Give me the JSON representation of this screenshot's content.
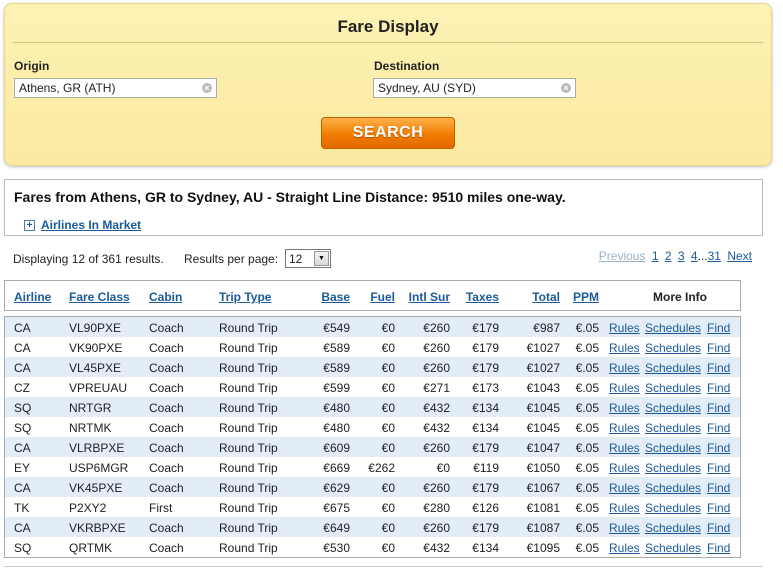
{
  "search": {
    "title": "Fare Display",
    "origin_label": "Origin",
    "origin_value": "Athens, GR (ATH)",
    "destination_label": "Destination",
    "destination_value": "Sydney, AU (SYD)",
    "clear_glyph": "×",
    "search_label": "SEARCH"
  },
  "info": {
    "title": "Fares from Athens, GR to Sydney, AU - Straight Line Distance: 9510 miles one-way.",
    "expand_glyph": "+",
    "airlines_link": "Airlines In Market"
  },
  "results": {
    "count_text": "Displaying 12 of 361 results.",
    "per_page_label": "Results per page:",
    "per_page_value": "12",
    "dropdown_glyph": "▼"
  },
  "pager": {
    "previous": "Previous",
    "pages": [
      "1",
      "2",
      "3",
      "4"
    ],
    "ellipsis": "...",
    "last": "31",
    "next": "Next"
  },
  "columns": {
    "airline": "Airline",
    "fare_class": "Fare Class",
    "cabin": "Cabin",
    "trip_type": "Trip Type",
    "base": "Base",
    "fuel": "Fuel",
    "intl_sur": "Intl Sur",
    "taxes": "Taxes",
    "total": "Total",
    "ppm": "PPM",
    "more_info": "More Info"
  },
  "link_labels": {
    "rules": "Rules",
    "schedules": "Schedules",
    "find": "Find"
  },
  "rows": [
    {
      "airline": "CA",
      "fare_class": "VL90PXE",
      "cabin": "Coach",
      "trip_type": "Round Trip",
      "base": "€549",
      "fuel": "€0",
      "intl_sur": "€260",
      "taxes": "€179",
      "total": "€987",
      "ppm": "€.05"
    },
    {
      "airline": "CA",
      "fare_class": "VK90PXE",
      "cabin": "Coach",
      "trip_type": "Round Trip",
      "base": "€589",
      "fuel": "€0",
      "intl_sur": "€260",
      "taxes": "€179",
      "total": "€1027",
      "ppm": "€.05"
    },
    {
      "airline": "CA",
      "fare_class": "VL45PXE",
      "cabin": "Coach",
      "trip_type": "Round Trip",
      "base": "€589",
      "fuel": "€0",
      "intl_sur": "€260",
      "taxes": "€179",
      "total": "€1027",
      "ppm": "€.05"
    },
    {
      "airline": "CZ",
      "fare_class": "VPREUAU",
      "cabin": "Coach",
      "trip_type": "Round Trip",
      "base": "€599",
      "fuel": "€0",
      "intl_sur": "€271",
      "taxes": "€173",
      "total": "€1043",
      "ppm": "€.05"
    },
    {
      "airline": "SQ",
      "fare_class": "NRTGR",
      "cabin": "Coach",
      "trip_type": "Round Trip",
      "base": "€480",
      "fuel": "€0",
      "intl_sur": "€432",
      "taxes": "€134",
      "total": "€1045",
      "ppm": "€.05"
    },
    {
      "airline": "SQ",
      "fare_class": "NRTMK",
      "cabin": "Coach",
      "trip_type": "Round Trip",
      "base": "€480",
      "fuel": "€0",
      "intl_sur": "€432",
      "taxes": "€134",
      "total": "€1045",
      "ppm": "€.05"
    },
    {
      "airline": "CA",
      "fare_class": "VLRBPXE",
      "cabin": "Coach",
      "trip_type": "Round Trip",
      "base": "€609",
      "fuel": "€0",
      "intl_sur": "€260",
      "taxes": "€179",
      "total": "€1047",
      "ppm": "€.05"
    },
    {
      "airline": "EY",
      "fare_class": "USP6MGR",
      "cabin": "Coach",
      "trip_type": "Round Trip",
      "base": "€669",
      "fuel": "€262",
      "intl_sur": "€0",
      "taxes": "€119",
      "total": "€1050",
      "ppm": "€.05"
    },
    {
      "airline": "CA",
      "fare_class": "VK45PXE",
      "cabin": "Coach",
      "trip_type": "Round Trip",
      "base": "€629",
      "fuel": "€0",
      "intl_sur": "€260",
      "taxes": "€179",
      "total": "€1067",
      "ppm": "€.05"
    },
    {
      "airline": "TK",
      "fare_class": "P2XY2",
      "cabin": "First",
      "trip_type": "Round Trip",
      "base": "€675",
      "fuel": "€0",
      "intl_sur": "€280",
      "taxes": "€126",
      "total": "€1081",
      "ppm": "€.05"
    },
    {
      "airline": "CA",
      "fare_class": "VKRBPXE",
      "cabin": "Coach",
      "trip_type": "Round Trip",
      "base": "€649",
      "fuel": "€0",
      "intl_sur": "€260",
      "taxes": "€179",
      "total": "€1087",
      "ppm": "€.05"
    },
    {
      "airline": "SQ",
      "fare_class": "QRTMK",
      "cabin": "Coach",
      "trip_type": "Round Trip",
      "base": "€530",
      "fuel": "€0",
      "intl_sur": "€432",
      "taxes": "€134",
      "total": "€1095",
      "ppm": "€.05"
    }
  ],
  "colors": {
    "panel_bg": "#fbeaa0",
    "button_orange": "#f07b00",
    "link_blue": "#1c5a99",
    "alt_row": "#e3edf7"
  }
}
